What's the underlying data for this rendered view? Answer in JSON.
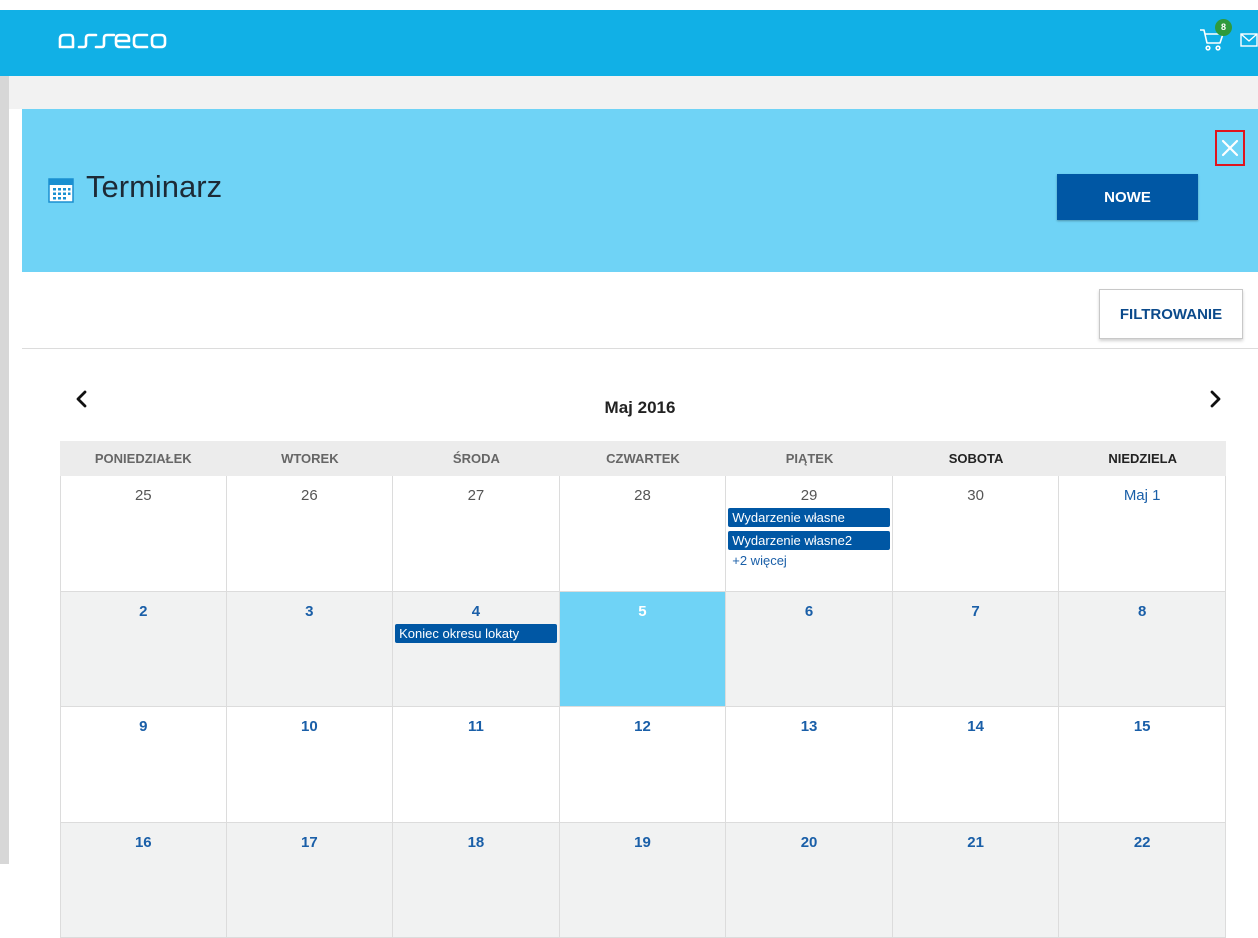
{
  "header": {
    "logo_text": "asseco",
    "cart_count": "8"
  },
  "page": {
    "title": "Terminarz",
    "new_button": "NOWE",
    "filter_button": "FILTROWANIE"
  },
  "calendar": {
    "month_title": "Maj 2016",
    "weekdays": [
      "PONIEDZIAŁEK",
      "WTOREK",
      "ŚRODA",
      "CZWARTEK",
      "PIĄTEK",
      "SOBOTA",
      "NIEDZIELA"
    ],
    "weeks": [
      [
        {
          "day": "25",
          "muted": true,
          "events": []
        },
        {
          "day": "26",
          "muted": true,
          "events": []
        },
        {
          "day": "27",
          "muted": true,
          "events": []
        },
        {
          "day": "28",
          "muted": true,
          "events": []
        },
        {
          "day": "29",
          "muted": true,
          "events": [
            "Wydarzenie własne",
            "Wydarzenie własne2"
          ],
          "more": "+2 więcej"
        },
        {
          "day": "30",
          "muted": true,
          "events": []
        },
        {
          "day": "Maj 1",
          "muted": false,
          "events": []
        }
      ],
      [
        {
          "day": "2",
          "events": []
        },
        {
          "day": "3",
          "events": []
        },
        {
          "day": "4",
          "events": [
            "Koniec okresu lokaty"
          ]
        },
        {
          "day": "5",
          "today": true,
          "events": []
        },
        {
          "day": "6",
          "events": []
        },
        {
          "day": "7",
          "events": []
        },
        {
          "day": "8",
          "events": []
        }
      ],
      [
        {
          "day": "9",
          "events": []
        },
        {
          "day": "10",
          "events": []
        },
        {
          "day": "11",
          "events": []
        },
        {
          "day": "12",
          "events": []
        },
        {
          "day": "13",
          "events": []
        },
        {
          "day": "14",
          "events": []
        },
        {
          "day": "15",
          "events": []
        }
      ],
      [
        {
          "day": "16",
          "events": []
        },
        {
          "day": "17",
          "events": []
        },
        {
          "day": "18",
          "events": []
        },
        {
          "day": "19",
          "events": []
        },
        {
          "day": "20",
          "events": []
        },
        {
          "day": "21",
          "events": []
        },
        {
          "day": "22",
          "events": []
        }
      ]
    ]
  },
  "colors": {
    "topbar": "#11b0e6",
    "hero": "#6fd3f6",
    "primary": "#0057a4",
    "badge": "#2e9a3c"
  },
  "icons": [
    "asseco-logo",
    "cart-icon",
    "mail-icon",
    "calendar-icon",
    "close-icon",
    "chevron-left-icon",
    "chevron-right-icon"
  ]
}
